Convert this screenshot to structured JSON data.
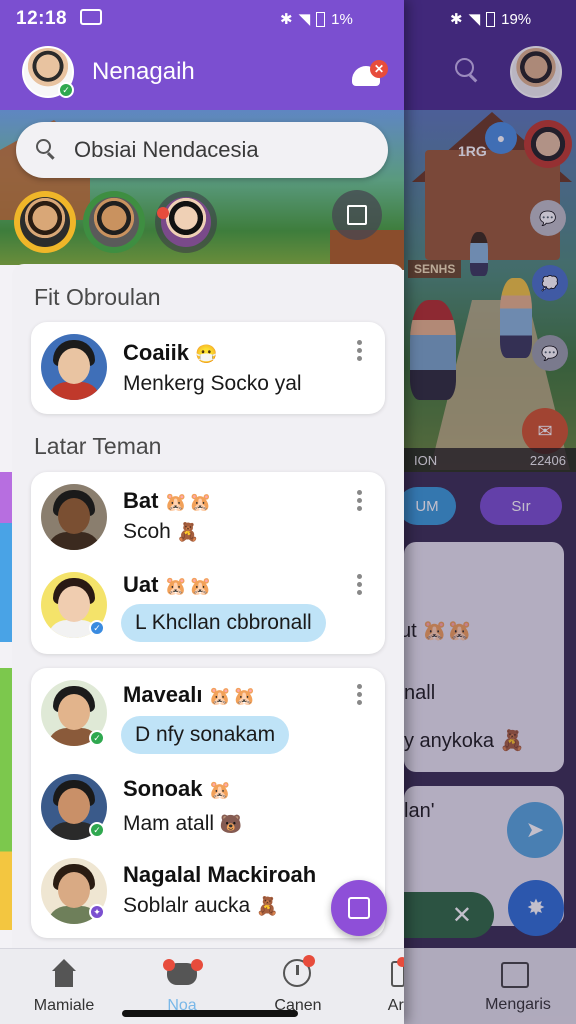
{
  "status_bar": {
    "time": "12:18",
    "battery_left": "1%",
    "battery_right": "19%"
  },
  "drawer": {
    "title": "Nenagaih",
    "search_placeholder": "Obsiai Nendacesia",
    "sections": {
      "pinned_label": "Fit Obroulan",
      "friends_label": "Latar Teman"
    },
    "pinned": [
      {
        "name": "Coaiik",
        "emoji": "😷",
        "message": "Menkerg Socko yal"
      }
    ],
    "friends_group_1": [
      {
        "name": "Bat",
        "emoji": "🐹🐹",
        "message": "Scoh",
        "trailing": "🧸"
      },
      {
        "name": "Uat",
        "emoji": "🐹🐹",
        "bubble": "L Khcllan cbbronall"
      }
    ],
    "friends_group_2": [
      {
        "name": "Mavealı",
        "emoji": "🐹🐹",
        "bubble": "D nfy sonakam"
      },
      {
        "name": "Sonoak",
        "emoji": "🐹",
        "message": "Mam atall",
        "trailing": "🐻"
      },
      {
        "name": "Nagalal Mackiroah",
        "emoji": "",
        "message": "Soblalr aucka",
        "trailing": "🧸"
      }
    ]
  },
  "bottom_nav": [
    {
      "label": "Mamiale",
      "icon": "home-icon"
    },
    {
      "label": "Noa",
      "icon": "chat-icon"
    },
    {
      "label": "Canen",
      "icon": "clock-icon"
    },
    {
      "label": "Arı",
      "icon": "phone-icon"
    },
    {
      "label": "Mengaris",
      "icon": "download-icon"
    }
  ],
  "background": {
    "hud_left": "ION",
    "hud_right": "22406",
    "scene_label": "1RG",
    "sign": "SENHS",
    "chip_left": "UM",
    "chip_right": "Sır",
    "card_texts": [
      "ut 🐹🐹",
      "nall",
      "y anykoka 🧸",
      "lan'"
    ]
  },
  "colors": {
    "primary": "#7b4fd0",
    "bubble": "#bfe3f7",
    "online": "#2fa84f",
    "alert": "#e74c3c"
  }
}
